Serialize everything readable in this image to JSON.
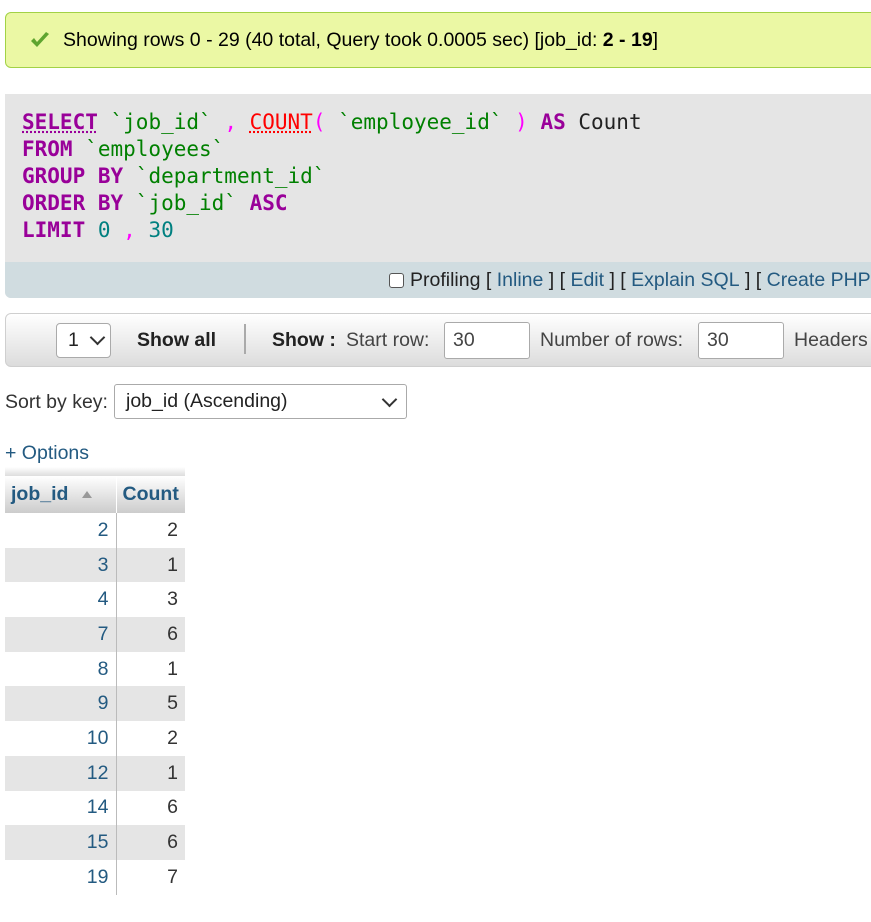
{
  "success": {
    "message_prefix": "Showing rows 0 - 29 (40 total, Query took 0.0005 sec) [job_id: ",
    "message_bold": "2 - 19",
    "message_suffix": "]",
    "icon": "check-icon",
    "color": "#ebf8a4"
  },
  "sql": {
    "line1": {
      "kw": "SELECT",
      "col": "`job_id`",
      "comma": " , ",
      "fn": "COUNT",
      "open": "( ",
      "arg": "`employee_id`",
      "close": " )",
      "as": " AS",
      "alias": " Count"
    },
    "line2": {
      "kw": "FROM",
      "tbl": " `employees`"
    },
    "line3": {
      "kw": "GROUP BY",
      "col": " `department_id`"
    },
    "line4": {
      "kw": "ORDER BY",
      "col": " `job_id`",
      "dir": " ASC"
    },
    "line5": {
      "kw": "LIMIT",
      "a": " 0",
      "comma": " ,",
      "b": " 30"
    },
    "toolbar": {
      "profiling": "Profiling",
      "inline": "Inline",
      "edit": "Edit",
      "explain": "Explain SQL",
      "create": "Create PHP"
    }
  },
  "nav": {
    "page_value": "1",
    "show_all": "Show all",
    "show_label": "Show :",
    "start_row_label": "Start row:",
    "start_row_value": "30",
    "num_rows_label": "Number of rows:",
    "num_rows_value": "30",
    "headers_label": "Headers"
  },
  "sort": {
    "label": "Sort by key:",
    "value": "job_id (Ascending)"
  },
  "options_link": "+ Options",
  "table": {
    "columns": [
      "job_id",
      "Count"
    ],
    "rows": [
      [
        "2",
        "2"
      ],
      [
        "3",
        "1"
      ],
      [
        "4",
        "3"
      ],
      [
        "7",
        "6"
      ],
      [
        "8",
        "1"
      ],
      [
        "9",
        "5"
      ],
      [
        "10",
        "2"
      ],
      [
        "12",
        "1"
      ],
      [
        "14",
        "6"
      ],
      [
        "15",
        "6"
      ],
      [
        "19",
        "7"
      ]
    ]
  },
  "colors": {
    "link": "#235a81",
    "keyword": "#990099",
    "string": "#008000",
    "function": "#ff0000"
  }
}
